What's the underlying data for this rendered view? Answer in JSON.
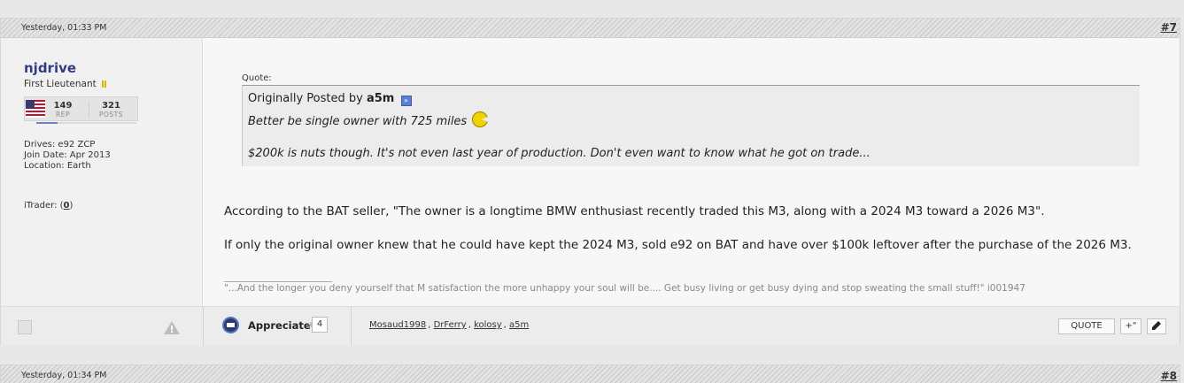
{
  "post1": {
    "date": "Yesterday, 01:33 PM",
    "number": "#7",
    "user": {
      "username": "njdrive",
      "rank": "First Lieutenant",
      "rep_value": "149",
      "rep_label": "REP",
      "posts_value": "321",
      "posts_label": "POSTS",
      "drives": "Drives: e92 ZCP",
      "join_date": "Join Date: Apr 2013",
      "location": "Location: Earth",
      "itrader_label": "iTrader: (",
      "itrader_value": "0",
      "itrader_close": ")"
    },
    "quote": {
      "label": "Quote:",
      "originally_posted_by": "Originally Posted by",
      "author": "a5m",
      "line1": "Better be single owner with 725 miles",
      "line2": "$200k is nuts though. It's not even last year of production. Don't even want to know what he got on trade..."
    },
    "body": {
      "paragraph1": "According to the BAT seller, \"The owner is a longtime BMW enthusiast recently traded this M3, along with a 2024 M3 toward a 2026 M3\".",
      "paragraph2": "If only the original owner knew that he could have kept the 2024 M3, sold e92 on BAT and have over $100k leftover after the purchase of the 2026 M3."
    },
    "signature": "\"...And the longer you deny yourself that M satisfaction the more unhappy your soul will be.... Get busy living or get busy dying and stop sweating the small stuff!\" i001947",
    "footer": {
      "appreciate_label": "Appreciate",
      "appreciate_count": "4",
      "thankers": [
        "Mosaud1998",
        "DrFerry",
        "kolosy",
        "a5m"
      ],
      "quote_button": "QUOTE",
      "multiquote_button": "+\""
    }
  },
  "post2": {
    "date": "Yesterday, 01:34 PM",
    "number": "#8"
  },
  "colors": {
    "username": "#303c85",
    "page_bg": "#e8e8e8"
  },
  "icons": [
    "us-flag-icon",
    "view-post-icon",
    "pacman-smiley-icon",
    "warning-icon",
    "appreciate-icon",
    "edit-pencil-icon"
  ]
}
